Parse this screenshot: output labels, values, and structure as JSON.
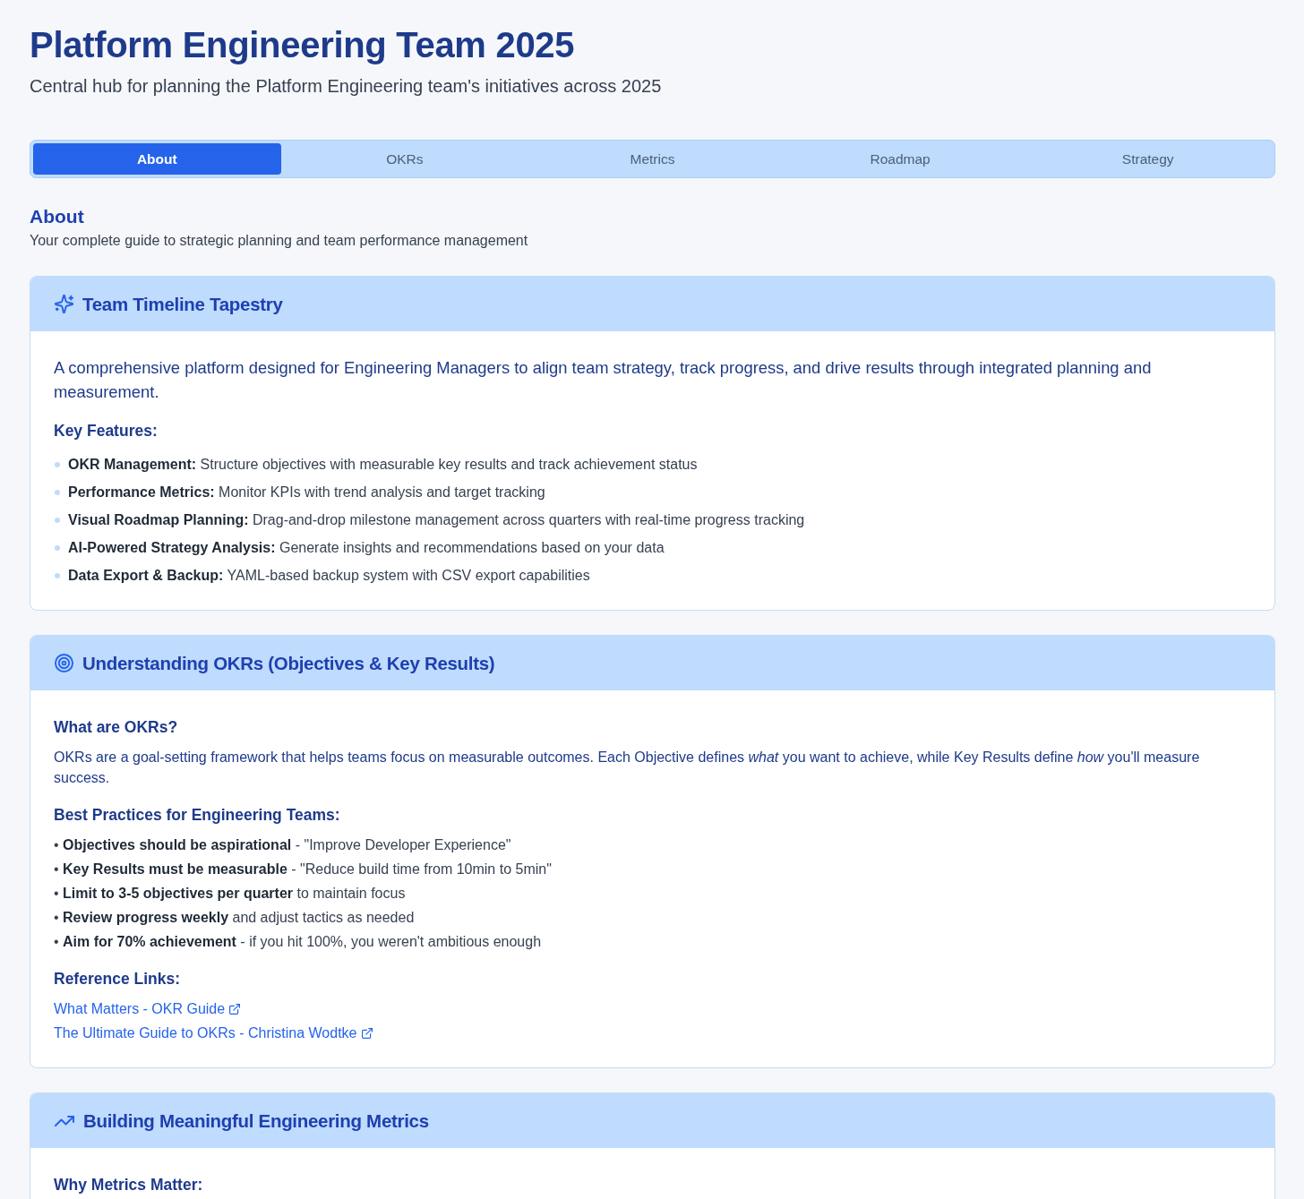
{
  "header": {
    "title": "Platform Engineering Team 2025",
    "subtitle": "Central hub for planning the Platform Engineering team's initiatives across 2025"
  },
  "tabs": [
    {
      "label": "About",
      "selected": true
    },
    {
      "label": "OKRs",
      "selected": false
    },
    {
      "label": "Metrics",
      "selected": false
    },
    {
      "label": "Roadmap",
      "selected": false
    },
    {
      "label": "Strategy",
      "selected": false
    }
  ],
  "section": {
    "title": "About",
    "subtitle": "Your complete guide to strategic planning and team performance management"
  },
  "cards": [
    {
      "title": "Team Timeline Tapestry",
      "blocks": [
        {
          "kind": "lead",
          "text": "A comprehensive platform designed for Engineering Managers to align team strategy, track progress, and drive results through integrated planning and measurement."
        },
        {
          "kind": "heading",
          "text": "Key Features:"
        },
        {
          "kind": "dot_list",
          "items": [
            "**OKR Management:** Structure objectives with measurable key results and track achievement status",
            "**Performance Metrics:** Monitor KPIs with trend analysis and target tracking",
            "**Visual Roadmap Planning:** Drag-and-drop milestone management across quarters with real-time progress tracking",
            "**AI-Powered Strategy Analysis:** Generate insights and recommendations based on your data",
            "**Data Export & Backup:** YAML-based backup system with CSV export capabilities"
          ]
        }
      ]
    },
    {
      "title": "Understanding OKRs (Objectives & Key Results)",
      "blocks": [
        {
          "kind": "heading",
          "text": "What are OKRs?"
        },
        {
          "kind": "paragraph",
          "text": "OKRs are a goal-setting framework that helps teams focus on measurable outcomes. Each Objective defines *what* you want to achieve, while Key Results define *how* you'll measure success."
        },
        {
          "kind": "heading",
          "text": "Best Practices for Engineering Teams:"
        },
        {
          "kind": "text_list",
          "items": [
            "• **Objectives should be aspirational** - \"Improve Developer Experience\"",
            "• **Key Results must be measurable** - \"Reduce build time from 10min to 5min\"",
            "• **Limit to 3-5 objectives per quarter** to maintain focus",
            "• **Review progress weekly** and adjust tactics as needed",
            "• **Aim for 70% achievement** - if you hit 100%, you weren't ambitious enough"
          ]
        },
        {
          "kind": "heading",
          "text": "Reference Links:"
        },
        {
          "kind": "links",
          "items": [
            "What Matters - OKR Guide",
            "The Ultimate Guide to OKRs - Christina Wodtke"
          ]
        }
      ]
    },
    {
      "title": "Building Meaningful Engineering Metrics",
      "blocks": [
        {
          "kind": "heading",
          "text": "Why Metrics Matter:"
        }
      ]
    }
  ]
}
